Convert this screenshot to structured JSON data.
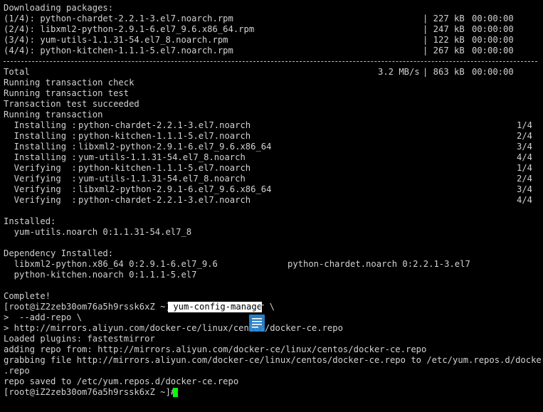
{
  "terminal": {
    "colors": {
      "background": "#000000",
      "foreground": "#d2d2d2",
      "cursor": "#00ff00",
      "selection_background": "#ffffff",
      "selection_text": "#000000",
      "icon": "#2f8ee0"
    },
    "header": "Downloading packages:",
    "downloads": [
      {
        "name": "(1/4): python-chardet-2.2.1-3.el7.noarch.rpm",
        "size": "| 227 kB",
        "time": "00:00:00"
      },
      {
        "name": "(2/4): libxml2-python-2.9.1-6.el7_9.6.x86_64.rpm",
        "size": "| 247 kB",
        "time": "00:00:00"
      },
      {
        "name": "(3/4): yum-utils-1.1.31-54.el7_8.noarch.rpm",
        "size": "| 122 kB",
        "time": "00:00:00"
      },
      {
        "name": "(4/4): python-kitchen-1.1.1-5.el7.noarch.rpm",
        "size": "| 267 kB",
        "time": "00:00:00"
      }
    ],
    "total": {
      "label": "Total",
      "speed": "3.2 MB/s",
      "size": "| 863 kB",
      "time": "00:00:00"
    },
    "messages": [
      "Running transaction check",
      "Running transaction test",
      "Transaction test succeeded",
      "Running transaction"
    ],
    "transaction_steps": [
      {
        "action": "  Installing :",
        "pkg": "python-chardet-2.2.1-3.el7.noarch",
        "count": "1/4"
      },
      {
        "action": "  Installing :",
        "pkg": "python-kitchen-1.1.1-5.el7.noarch",
        "count": "2/4"
      },
      {
        "action": "  Installing :",
        "pkg": "libxml2-python-2.9.1-6.el7_9.6.x86_64",
        "count": "3/4"
      },
      {
        "action": "  Installing :",
        "pkg": "yum-utils-1.1.31-54.el7_8.noarch",
        "count": "4/4"
      },
      {
        "action": "  Verifying  :",
        "pkg": "python-kitchen-1.1.1-5.el7.noarch",
        "count": "1/4"
      },
      {
        "action": "  Verifying  :",
        "pkg": "yum-utils-1.1.31-54.el7_8.noarch",
        "count": "2/4"
      },
      {
        "action": "  Verifying  :",
        "pkg": "libxml2-python-2.9.1-6.el7_9.6.x86_64",
        "count": "3/4"
      },
      {
        "action": "  Verifying  :",
        "pkg": "python-chardet-2.2.1-3.el7.noarch",
        "count": "4/4"
      }
    ],
    "installed_header": "Installed:",
    "installed_pkg": "  yum-utils.noarch 0:1.1.31-54.el7_8",
    "dependency_header": "Dependency Installed:",
    "dep_left_1": "  libxml2-python.x86_64 0:2.9.1-6.el7_9.6",
    "dep_right_1": "python-chardet.noarch 0:2.2.1-3.el7",
    "dep_left_2": "  python-kitchen.noarch 0:1.1.1-5.el7",
    "complete": "Complete!",
    "prompt": "[root@iZ2zeb30om76a5h9rssk6xZ ~]#",
    "command_selected": " yum-config-manage",
    "command_rest": "r \\",
    "cont_1": ">  --add-repo \\",
    "cont_2": "> http://mirrors.aliyun.com/docker-ce/linux/centos/docker-ce.repo",
    "output": [
      "Loaded plugins: fastestmirror",
      "adding repo from: http://mirrors.aliyun.com/docker-ce/linux/centos/docker-ce.repo",
      "grabbing file http://mirrors.aliyun.com/docker-ce/linux/centos/docker-ce.repo to /etc/yum.repos.d/docker-ce",
      ".repo",
      "repo saved to /etc/yum.repos.d/docker-ce.repo"
    ],
    "final_prompt": "[root@iZ2zeb30om76a5h9rssk6xZ ~]# ",
    "floating_icon": "document-icon"
  }
}
